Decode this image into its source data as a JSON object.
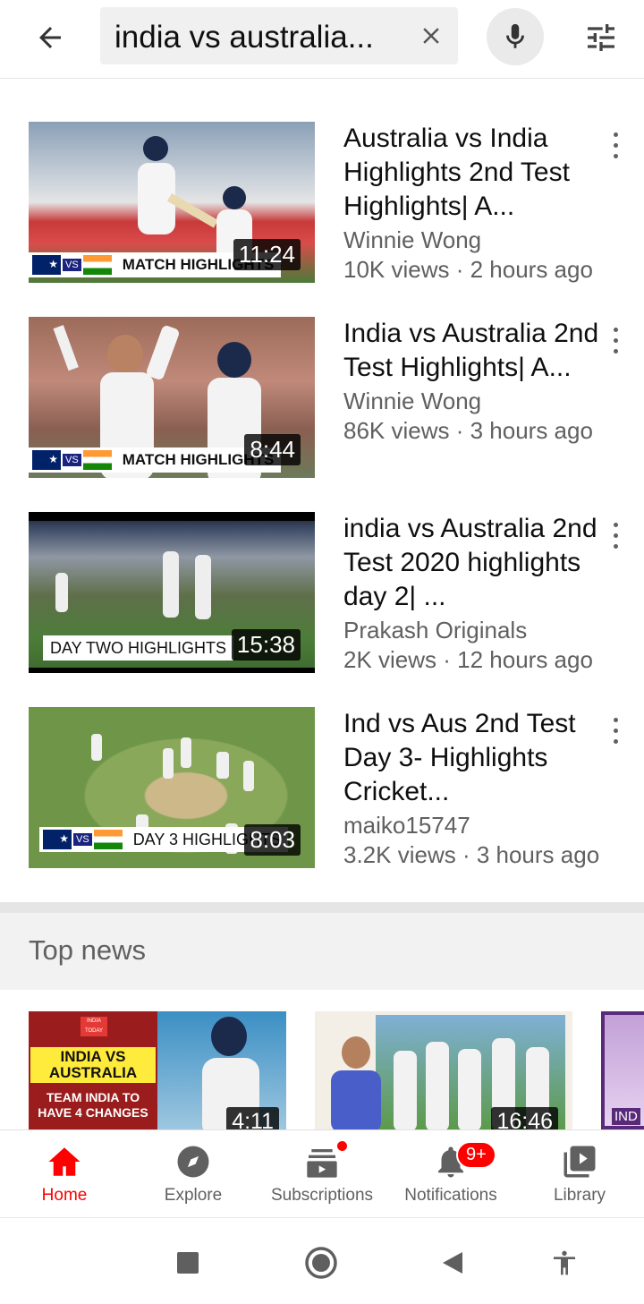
{
  "search": {
    "query": "india vs australia...",
    "clear_label": "clear search",
    "mic_label": "voice search"
  },
  "videos": [
    {
      "title": "Australia vs India Highlights 2nd Test Highlights| A...",
      "channel": "Winnie Wong",
      "meta": "10K views · 2 hours ago",
      "duration": "11:24",
      "banner": "MATCH HIGHLIGHTS",
      "vs_label": "VS"
    },
    {
      "title": "India vs Australia 2nd Test Highlights| A...",
      "channel": "Winnie Wong",
      "meta": "86K views · 3 hours ago",
      "duration": "8:44",
      "banner": "MATCH HIGHLIGHTS",
      "vs_label": "VS"
    },
    {
      "title": "india vs Australia 2nd Test 2020 highlights day 2| ...",
      "channel": "Prakash Originals",
      "meta": "2K views · 12 hours ago",
      "duration": "15:38",
      "banner": "DAY TWO HIGHLIGHTS"
    },
    {
      "title": "Ind vs Aus 2nd Test Day 3- Highlights Cricket...",
      "channel": "maiko15747",
      "meta": "3.2K views · 3 hours ago",
      "duration": "8:03",
      "banner": "DAY 3 HIGHLIGHTS",
      "vs_label": "VS"
    }
  ],
  "top_news": {
    "heading": "Top news",
    "cards": [
      {
        "duration": "4:11",
        "headline": "INDIA VS AUSTRALIA",
        "subline": "TEAM INDIA TO HAVE 4 CHANGES",
        "logo": "INDIA TODAY"
      },
      {
        "duration": "16:46"
      },
      {
        "label": "IND"
      }
    ]
  },
  "bottom_nav": {
    "items": [
      {
        "label": "Home",
        "icon": "home-icon",
        "active": true
      },
      {
        "label": "Explore",
        "icon": "compass-icon"
      },
      {
        "label": "Subscriptions",
        "icon": "subscriptions-icon"
      },
      {
        "label": "Notifications",
        "icon": "bell-icon",
        "badge": "9+"
      },
      {
        "label": "Library",
        "icon": "library-icon"
      }
    ]
  },
  "colors": {
    "accent": "#ff0000",
    "secondary_text": "#606060"
  }
}
